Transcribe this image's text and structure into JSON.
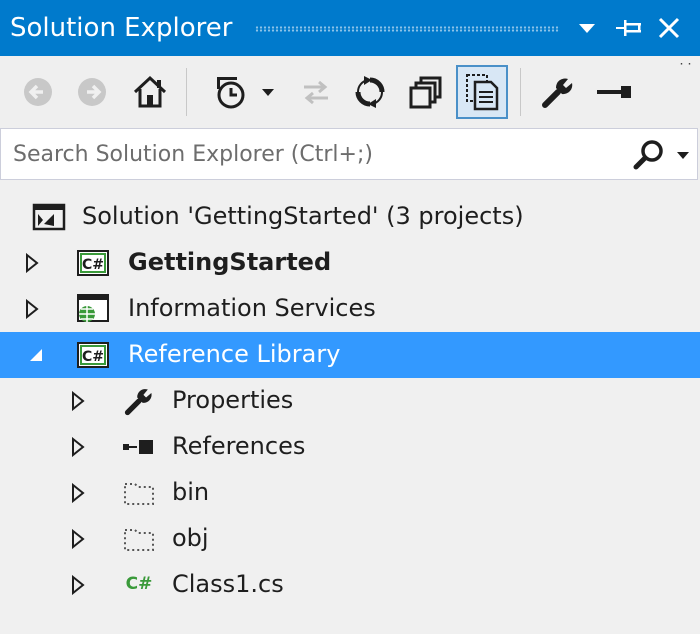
{
  "titlebar": {
    "title": "Solution Explorer",
    "buttons": [
      {
        "name": "window-position-dropdown",
        "icon": "chevron-down-icon"
      },
      {
        "name": "pin-button",
        "icon": "pin-icon"
      },
      {
        "name": "close-button",
        "icon": "close-icon"
      }
    ],
    "color": "#007acc"
  },
  "toolbar": {
    "buttons": [
      {
        "name": "back-button",
        "icon": "back-arrow-icon",
        "enabled": false
      },
      {
        "name": "forward-button",
        "icon": "forward-arrow-icon",
        "enabled": false
      },
      {
        "name": "home-button",
        "icon": "home-icon",
        "enabled": true
      },
      {
        "name": "pending-changes-filter-button",
        "icon": "clock-filter-icon",
        "enabled": true
      },
      {
        "name": "filter-dropdown",
        "icon": "chevron-down-icon",
        "enabled": true
      },
      {
        "name": "sync-active-document-button",
        "icon": "sync-arrows-icon",
        "enabled": false
      },
      {
        "name": "refresh-button",
        "icon": "refresh-icon",
        "enabled": true
      },
      {
        "name": "collapse-all-button",
        "icon": "collapse-all-icon",
        "enabled": true
      },
      {
        "name": "show-all-files-button",
        "icon": "show-all-files-icon",
        "enabled": true,
        "active": true
      },
      {
        "name": "properties-button",
        "icon": "wrench-icon",
        "enabled": true
      },
      {
        "name": "preview-button",
        "icon": "minus-icon",
        "enabled": true
      }
    ],
    "overflow": "˙˙"
  },
  "search": {
    "placeholder": "Search Solution Explorer (Ctrl+;)",
    "value": ""
  },
  "tree": {
    "solution": {
      "label": "Solution 'GettingStarted' (3 projects)",
      "icon": "solution-icon"
    },
    "items": [
      {
        "label": "GettingStarted",
        "icon": "csharp-project-icon",
        "expanded": false,
        "bold": true
      },
      {
        "label": "Information Services",
        "icon": "web-project-icon",
        "expanded": false
      },
      {
        "label": "Reference Library",
        "icon": "csharp-project-icon",
        "expanded": true,
        "selected": true
      },
      {
        "label": "Properties",
        "icon": "wrench-icon",
        "expanded": false
      },
      {
        "label": "References",
        "icon": "references-icon",
        "expanded": false
      },
      {
        "label": "bin",
        "icon": "folder-dotted-icon",
        "expanded": false
      },
      {
        "label": "obj",
        "icon": "folder-dotted-icon",
        "expanded": false
      },
      {
        "label": "Class1.cs",
        "icon": "csharp-file-icon",
        "expanded": false
      }
    ],
    "selection_color": "#3399ff"
  }
}
